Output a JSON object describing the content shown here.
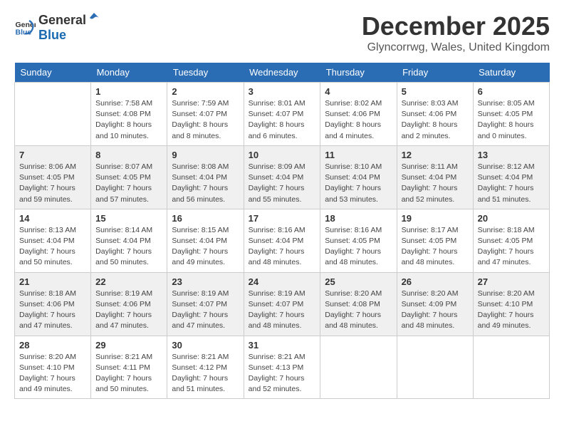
{
  "logo": {
    "general": "General",
    "blue": "Blue"
  },
  "title": "December 2025",
  "location": "Glyncorrwg, Wales, United Kingdom",
  "days_of_week": [
    "Sunday",
    "Monday",
    "Tuesday",
    "Wednesday",
    "Thursday",
    "Friday",
    "Saturday"
  ],
  "weeks": [
    [
      {
        "day": "",
        "sunrise": "",
        "sunset": "",
        "daylight": ""
      },
      {
        "day": "1",
        "sunrise": "Sunrise: 7:58 AM",
        "sunset": "Sunset: 4:08 PM",
        "daylight": "Daylight: 8 hours and 10 minutes."
      },
      {
        "day": "2",
        "sunrise": "Sunrise: 7:59 AM",
        "sunset": "Sunset: 4:07 PM",
        "daylight": "Daylight: 8 hours and 8 minutes."
      },
      {
        "day": "3",
        "sunrise": "Sunrise: 8:01 AM",
        "sunset": "Sunset: 4:07 PM",
        "daylight": "Daylight: 8 hours and 6 minutes."
      },
      {
        "day": "4",
        "sunrise": "Sunrise: 8:02 AM",
        "sunset": "Sunset: 4:06 PM",
        "daylight": "Daylight: 8 hours and 4 minutes."
      },
      {
        "day": "5",
        "sunrise": "Sunrise: 8:03 AM",
        "sunset": "Sunset: 4:06 PM",
        "daylight": "Daylight: 8 hours and 2 minutes."
      },
      {
        "day": "6",
        "sunrise": "Sunrise: 8:05 AM",
        "sunset": "Sunset: 4:05 PM",
        "daylight": "Daylight: 8 hours and 0 minutes."
      }
    ],
    [
      {
        "day": "7",
        "sunrise": "Sunrise: 8:06 AM",
        "sunset": "Sunset: 4:05 PM",
        "daylight": "Daylight: 7 hours and 59 minutes."
      },
      {
        "day": "8",
        "sunrise": "Sunrise: 8:07 AM",
        "sunset": "Sunset: 4:05 PM",
        "daylight": "Daylight: 7 hours and 57 minutes."
      },
      {
        "day": "9",
        "sunrise": "Sunrise: 8:08 AM",
        "sunset": "Sunset: 4:04 PM",
        "daylight": "Daylight: 7 hours and 56 minutes."
      },
      {
        "day": "10",
        "sunrise": "Sunrise: 8:09 AM",
        "sunset": "Sunset: 4:04 PM",
        "daylight": "Daylight: 7 hours and 55 minutes."
      },
      {
        "day": "11",
        "sunrise": "Sunrise: 8:10 AM",
        "sunset": "Sunset: 4:04 PM",
        "daylight": "Daylight: 7 hours and 53 minutes."
      },
      {
        "day": "12",
        "sunrise": "Sunrise: 8:11 AM",
        "sunset": "Sunset: 4:04 PM",
        "daylight": "Daylight: 7 hours and 52 minutes."
      },
      {
        "day": "13",
        "sunrise": "Sunrise: 8:12 AM",
        "sunset": "Sunset: 4:04 PM",
        "daylight": "Daylight: 7 hours and 51 minutes."
      }
    ],
    [
      {
        "day": "14",
        "sunrise": "Sunrise: 8:13 AM",
        "sunset": "Sunset: 4:04 PM",
        "daylight": "Daylight: 7 hours and 50 minutes."
      },
      {
        "day": "15",
        "sunrise": "Sunrise: 8:14 AM",
        "sunset": "Sunset: 4:04 PM",
        "daylight": "Daylight: 7 hours and 50 minutes."
      },
      {
        "day": "16",
        "sunrise": "Sunrise: 8:15 AM",
        "sunset": "Sunset: 4:04 PM",
        "daylight": "Daylight: 7 hours and 49 minutes."
      },
      {
        "day": "17",
        "sunrise": "Sunrise: 8:16 AM",
        "sunset": "Sunset: 4:04 PM",
        "daylight": "Daylight: 7 hours and 48 minutes."
      },
      {
        "day": "18",
        "sunrise": "Sunrise: 8:16 AM",
        "sunset": "Sunset: 4:05 PM",
        "daylight": "Daylight: 7 hours and 48 minutes."
      },
      {
        "day": "19",
        "sunrise": "Sunrise: 8:17 AM",
        "sunset": "Sunset: 4:05 PM",
        "daylight": "Daylight: 7 hours and 48 minutes."
      },
      {
        "day": "20",
        "sunrise": "Sunrise: 8:18 AM",
        "sunset": "Sunset: 4:05 PM",
        "daylight": "Daylight: 7 hours and 47 minutes."
      }
    ],
    [
      {
        "day": "21",
        "sunrise": "Sunrise: 8:18 AM",
        "sunset": "Sunset: 4:06 PM",
        "daylight": "Daylight: 7 hours and 47 minutes."
      },
      {
        "day": "22",
        "sunrise": "Sunrise: 8:19 AM",
        "sunset": "Sunset: 4:06 PM",
        "daylight": "Daylight: 7 hours and 47 minutes."
      },
      {
        "day": "23",
        "sunrise": "Sunrise: 8:19 AM",
        "sunset": "Sunset: 4:07 PM",
        "daylight": "Daylight: 7 hours and 47 minutes."
      },
      {
        "day": "24",
        "sunrise": "Sunrise: 8:19 AM",
        "sunset": "Sunset: 4:07 PM",
        "daylight": "Daylight: 7 hours and 48 minutes."
      },
      {
        "day": "25",
        "sunrise": "Sunrise: 8:20 AM",
        "sunset": "Sunset: 4:08 PM",
        "daylight": "Daylight: 7 hours and 48 minutes."
      },
      {
        "day": "26",
        "sunrise": "Sunrise: 8:20 AM",
        "sunset": "Sunset: 4:09 PM",
        "daylight": "Daylight: 7 hours and 48 minutes."
      },
      {
        "day": "27",
        "sunrise": "Sunrise: 8:20 AM",
        "sunset": "Sunset: 4:10 PM",
        "daylight": "Daylight: 7 hours and 49 minutes."
      }
    ],
    [
      {
        "day": "28",
        "sunrise": "Sunrise: 8:20 AM",
        "sunset": "Sunset: 4:10 PM",
        "daylight": "Daylight: 7 hours and 49 minutes."
      },
      {
        "day": "29",
        "sunrise": "Sunrise: 8:21 AM",
        "sunset": "Sunset: 4:11 PM",
        "daylight": "Daylight: 7 hours and 50 minutes."
      },
      {
        "day": "30",
        "sunrise": "Sunrise: 8:21 AM",
        "sunset": "Sunset: 4:12 PM",
        "daylight": "Daylight: 7 hours and 51 minutes."
      },
      {
        "day": "31",
        "sunrise": "Sunrise: 8:21 AM",
        "sunset": "Sunset: 4:13 PM",
        "daylight": "Daylight: 7 hours and 52 minutes."
      },
      {
        "day": "",
        "sunrise": "",
        "sunset": "",
        "daylight": ""
      },
      {
        "day": "",
        "sunrise": "",
        "sunset": "",
        "daylight": ""
      },
      {
        "day": "",
        "sunrise": "",
        "sunset": "",
        "daylight": ""
      }
    ]
  ]
}
